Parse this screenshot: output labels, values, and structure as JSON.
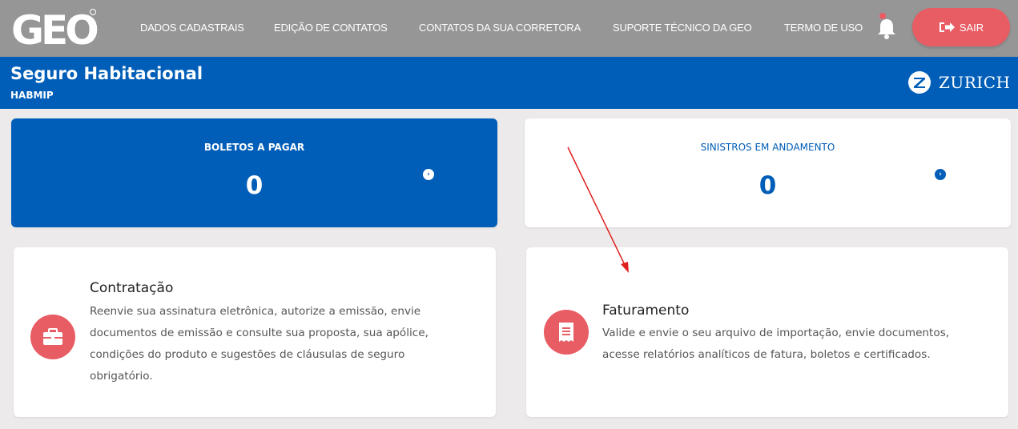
{
  "header": {
    "logo_text": "GEO",
    "nav": [
      {
        "label": "DADOS CADASTRAIS"
      },
      {
        "label": "EDIÇÃO DE CONTATOS"
      },
      {
        "label": "CONTATOS DA SUA CORRETORA"
      },
      {
        "label": "SUPORTE TÉCNICO DA GEO"
      },
      {
        "label": "TERMO DE USO"
      }
    ],
    "logout_label": "SAIR",
    "notification_icon": "bell-icon"
  },
  "banner": {
    "title": "Seguro Habitacional",
    "subtitle": "HABMIP",
    "brand": "ZURICH"
  },
  "stats": [
    {
      "label": "BOLETOS A PAGAR",
      "value": "0"
    },
    {
      "label": "SINISTROS EM ANDAMENTO",
      "value": "0"
    }
  ],
  "services": [
    {
      "title": "Contratação",
      "icon": "briefcase-icon",
      "description_lines": [
        "Reenvie sua assinatura eletrônica, autorize a emissão, envie",
        "documentos de emissão e consulte sua proposta, sua apólice,",
        "condições do produto e sugestões de cláusulas de seguro",
        "obrigatório."
      ]
    },
    {
      "title": "Faturamento",
      "icon": "receipt-icon",
      "description_lines": [
        "Valide e envie o seu arquivo de importação, envie documentos,",
        "acesse relatórios analíticos de fatura, boletos e certificados."
      ]
    }
  ],
  "colors": {
    "topbar": "#969696",
    "primary_blue": "#005eb8",
    "accent_red": "#e85c63",
    "background": "#eceaea",
    "annotation_arrow": "#e0201e"
  }
}
